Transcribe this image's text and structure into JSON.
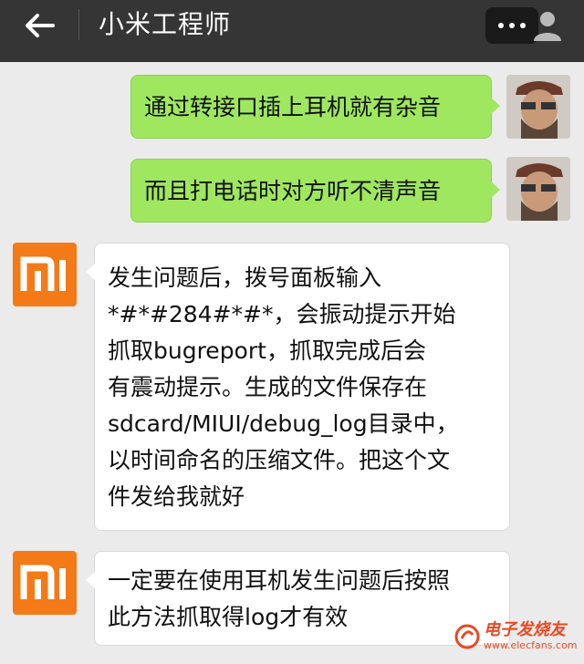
{
  "header": {
    "title": "小米工程师"
  },
  "colors": {
    "header_bg": "#353535",
    "chat_bg": "#ebebeb",
    "outgoing_bubble": "#9fe75f",
    "incoming_bubble": "#ffffff",
    "mi_brand": "#f47a18"
  },
  "icons": {
    "back": "back-arrow-icon",
    "more": "more-dots-icon",
    "contact": "person-icon",
    "user_avatar": "user-avatar",
    "mi_avatar": "mi-logo-avatar"
  },
  "messages": [
    {
      "sender": "user",
      "lines": [
        "通过转接口插上耳机就有杂音"
      ]
    },
    {
      "sender": "user",
      "lines": [
        "而且打电话时对方听不清声音"
      ]
    },
    {
      "sender": "mi",
      "lines": [
        "发生问题后，拨号面板输入",
        "*#*#284#*#*，会振动提示开始",
        "抓取bugreport，抓取完成后会",
        "有震动提示。生成的文件保存在",
        "sdcard/MIUI/debug_log目录中，",
        "以时间命名的压缩文件。把这个文",
        "件发给我就好"
      ]
    },
    {
      "sender": "mi",
      "lines": [
        "一定要在使用耳机发生问题后按照",
        "此方法抓取得log才有效"
      ]
    }
  ],
  "watermark": {
    "name": "电子发烧友",
    "url": "www.elecfans.com"
  }
}
